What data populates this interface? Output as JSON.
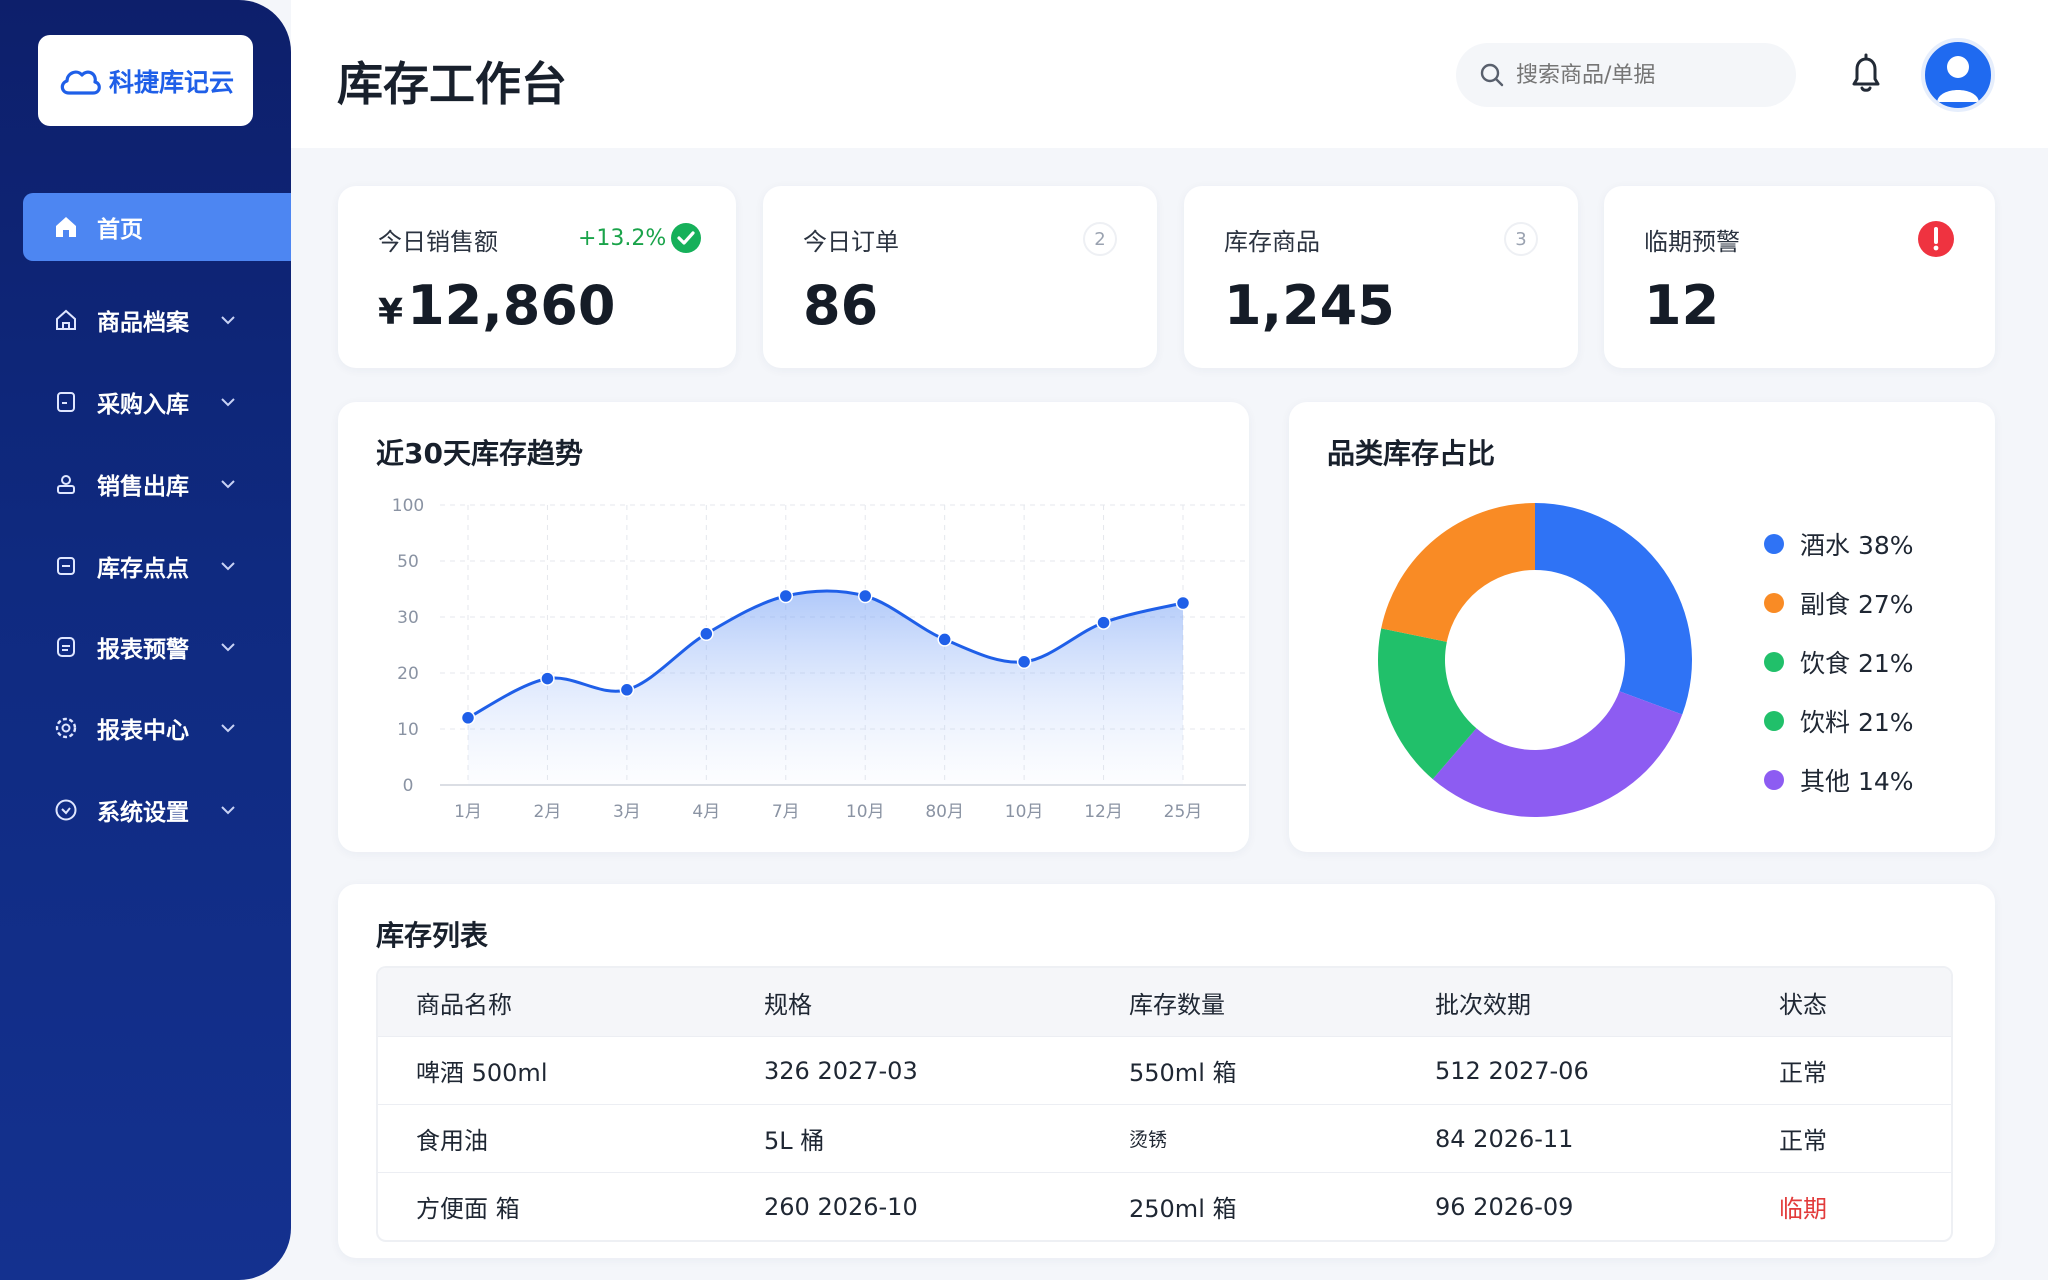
{
  "brand": {
    "name": "科捷库记云"
  },
  "sidebar": {
    "items": [
      {
        "label": "首页",
        "icon": "home-icon",
        "active": true
      },
      {
        "label": "商品档案",
        "icon": "home-outline-icon"
      },
      {
        "label": "采购入库",
        "icon": "document-icon"
      },
      {
        "label": "销售出库",
        "icon": "user-stack-icon"
      },
      {
        "label": "库存点点",
        "icon": "box-icon"
      },
      {
        "label": "报表预警",
        "icon": "report-icon"
      },
      {
        "label": "报表中心",
        "icon": "gear-icon"
      },
      {
        "label": "系统设置",
        "icon": "settings-circle-icon"
      }
    ]
  },
  "header": {
    "title": "库存工作台",
    "search_placeholder": "搜索商品/单据"
  },
  "kpis": {
    "sales": {
      "label": "今日销售额",
      "currency": "¥",
      "value": "12,860",
      "delta": "+13.2%"
    },
    "orders": {
      "label": "今日订单",
      "value": "86",
      "badge": "2"
    },
    "stock": {
      "label": "库存商品",
      "value": "1,245",
      "badge": "3"
    },
    "expiry": {
      "label": "临期预警",
      "value": "12"
    }
  },
  "trend": {
    "title": "近30天库存趋势"
  },
  "chart_data": [
    {
      "type": "line",
      "title": "近30天库存趋势",
      "categories": [
        "1月",
        "2月",
        "3月",
        "4月",
        "7月",
        "10月",
        "80月",
        "10月",
        "12月",
        "25月"
      ],
      "y_tick_labels": [
        "0",
        "10",
        "20",
        "30",
        "50",
        "100"
      ],
      "values": [
        12,
        19,
        17,
        27,
        37.5,
        37.5,
        26,
        22,
        29,
        35
      ],
      "ylim": [
        0,
        50
      ],
      "grid": true,
      "area_fill": true,
      "color": "#1f5fe8"
    },
    {
      "type": "pie",
      "title": "品类库存占比",
      "donut": true,
      "slices": [
        {
          "name": "酒水",
          "value": 38,
          "color": "#2f73f5"
        },
        {
          "name": "副食",
          "value": 27,
          "color": "#f98b25"
        },
        {
          "name": "饮食",
          "value": 21,
          "color": "#21c06a"
        },
        {
          "name": "饮料",
          "value": 21,
          "color": "#21c06a"
        },
        {
          "name": "其他",
          "value": 14,
          "color": "#8d5cf2"
        }
      ],
      "legend_labels": [
        "酒水 38%",
        "副食 27%",
        "饮食 21%",
        "饮料 21%",
        "其他 14%"
      ]
    }
  ],
  "table": {
    "title": "库存列表",
    "headers": [
      "商品名称",
      "规格",
      "库存数量",
      "批次效期",
      "状态"
    ],
    "rows": [
      [
        "啤酒 500ml",
        "326  2027-03",
        "550ml   箱",
        "512  2027-06",
        "正常"
      ],
      [
        "食用油",
        "5L   桶",
        "烫锈",
        "84  2026-11",
        "正常"
      ],
      [
        "方便面  箱",
        "260  2026-10",
        "250ml   箱",
        "96  2026-09",
        "临期"
      ]
    ],
    "status_colors": {
      "正常": "#1f2733",
      "临期": "#e23b3b"
    }
  }
}
